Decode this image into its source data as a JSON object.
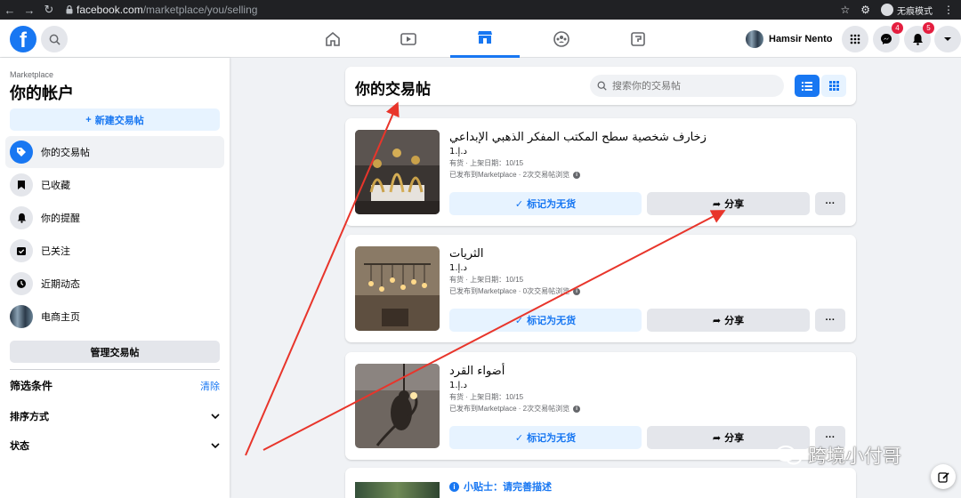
{
  "browser": {
    "url_host": "facebook.com",
    "url_path": "/marketplace/you/selling",
    "incognito_label": "无痕模式"
  },
  "topbar": {
    "profile_name": "Hamsir Nento",
    "messenger_badge": "4",
    "notifications_badge": "5"
  },
  "sidebar": {
    "crumb": "Marketplace",
    "title": "你的帐户",
    "new_listing": "新建交易帖",
    "items": [
      {
        "label": "你的交易帖",
        "icon": "tag-icon"
      },
      {
        "label": "已收藏",
        "icon": "bookmark-icon"
      },
      {
        "label": "你的提醒",
        "icon": "bell-icon"
      },
      {
        "label": "已关注",
        "icon": "calendar-check-icon"
      },
      {
        "label": "近期动态",
        "icon": "clock-icon"
      },
      {
        "label": "电商主页",
        "icon": "shop-avatar-icon"
      }
    ],
    "manage": "管理交易帖",
    "filters_title": "筛选条件",
    "clear": "清除",
    "sort_label": "排序方式",
    "status_label": "状态"
  },
  "main": {
    "title": "你的交易帖",
    "search_placeholder": "搜索你的交易帖",
    "listings": [
      {
        "title": "زخارف شخصية سطح المكتب المفكر الذهبي الإبداعي",
        "price": "د.إ.1",
        "meta": "有货 · 上架日期：10/15",
        "meta2": "已发布到Marketplace · 2次交易帖浏览",
        "mark_label": "标记为无货",
        "share_label": "分享",
        "more_label": "···"
      },
      {
        "title": "الثريات",
        "price": "د.إ.1",
        "meta": "有货 · 上架日期：10/15",
        "meta2": "已发布到Marketplace · 0次交易帖浏览",
        "mark_label": "标记为无货",
        "share_label": "分享",
        "more_label": "···"
      },
      {
        "title": "أضواء القرد",
        "price": "د.إ.1",
        "meta": "有货 · 上架日期：10/15",
        "meta2": "已发布到Marketplace · 2次交易帖浏览",
        "mark_label": "标记为无货",
        "share_label": "分享",
        "more_label": "···"
      }
    ],
    "tip_label": "小贴士：请完善描述"
  },
  "watermark": "跨境小付哥",
  "colors": {
    "accent": "#1877f2",
    "annotation_arrow": "#e8352b",
    "badge": "#e41e3f"
  }
}
